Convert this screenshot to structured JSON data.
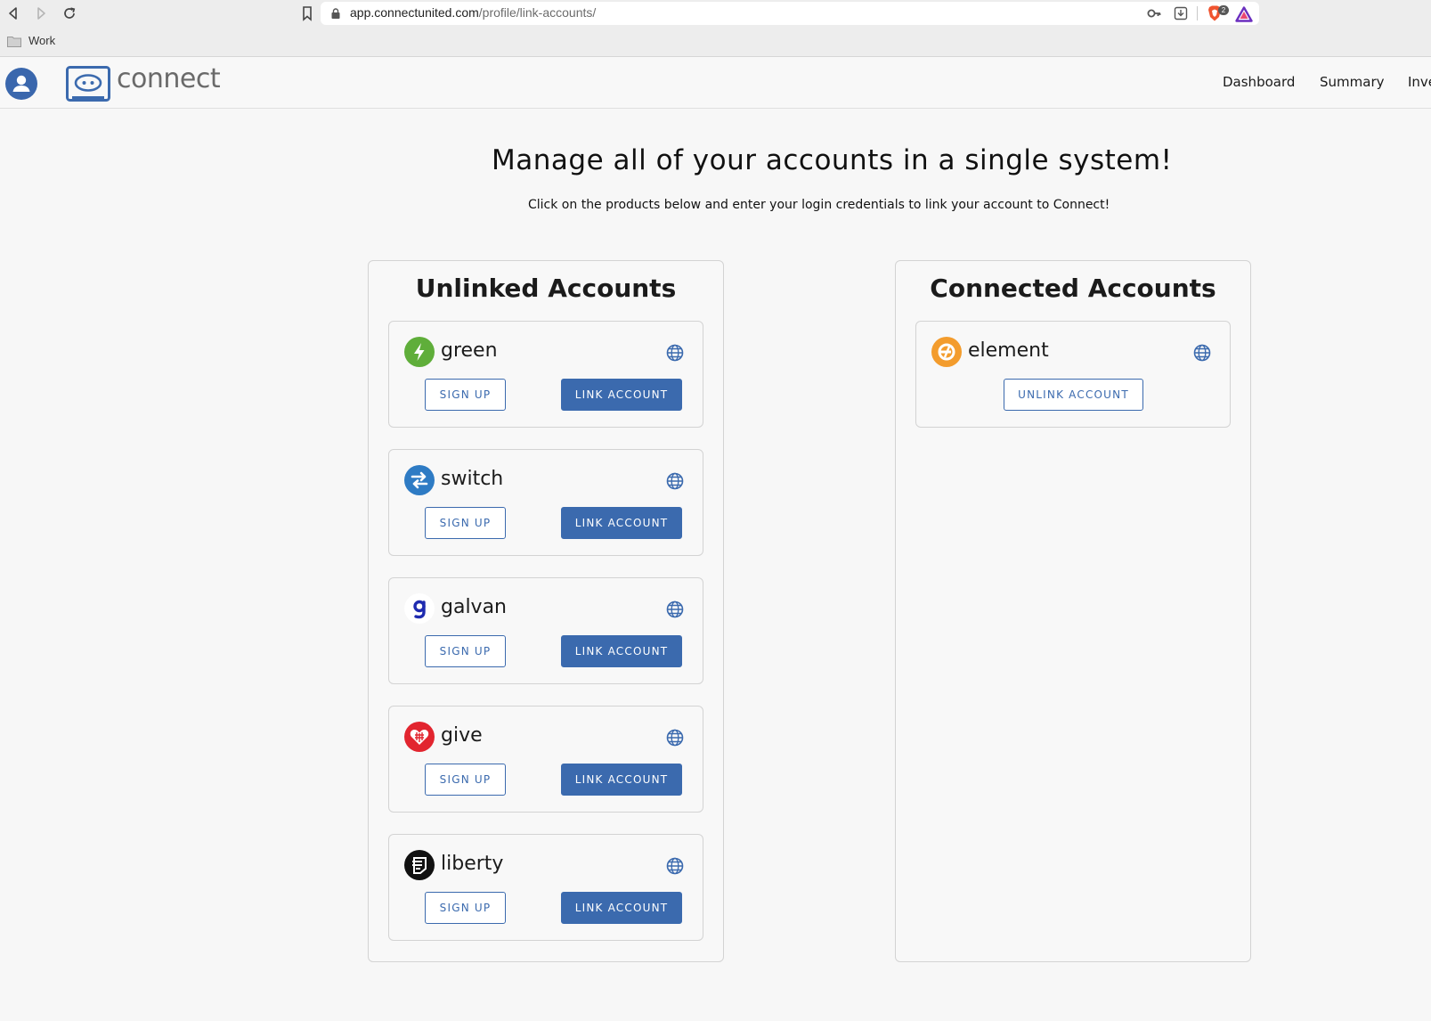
{
  "browser": {
    "url_host": "app.connectunited.com",
    "url_path": "/profile/link-accounts/",
    "bookmark_folder": "Work",
    "shields_count": "2"
  },
  "header": {
    "logo_text": "connect",
    "nav": [
      "Dashboard",
      "Summary",
      "Inve"
    ]
  },
  "main": {
    "title": "Manage all of your accounts in a single system!",
    "subtitle": "Click on the products below and enter your login credentials to link your account to Connect!"
  },
  "unlinked": {
    "title": "Unlinked Accounts",
    "signup_label": "SIGN UP",
    "link_label": "LINK ACCOUNT",
    "accounts": [
      {
        "name": "green",
        "color": "#5fae3a"
      },
      {
        "name": "switch",
        "color": "#2e7bc4"
      },
      {
        "name": "galvan",
        "color": "#1f2bb0"
      },
      {
        "name": "give",
        "color": "#e2252f"
      },
      {
        "name": "liberty",
        "color": "#111111"
      }
    ]
  },
  "connected": {
    "title": "Connected Accounts",
    "unlink_label": "UNLINK ACCOUNT",
    "accounts": [
      {
        "name": "element",
        "color": "#f39c2d"
      }
    ]
  },
  "colors": {
    "primary": "#3b6aae"
  }
}
